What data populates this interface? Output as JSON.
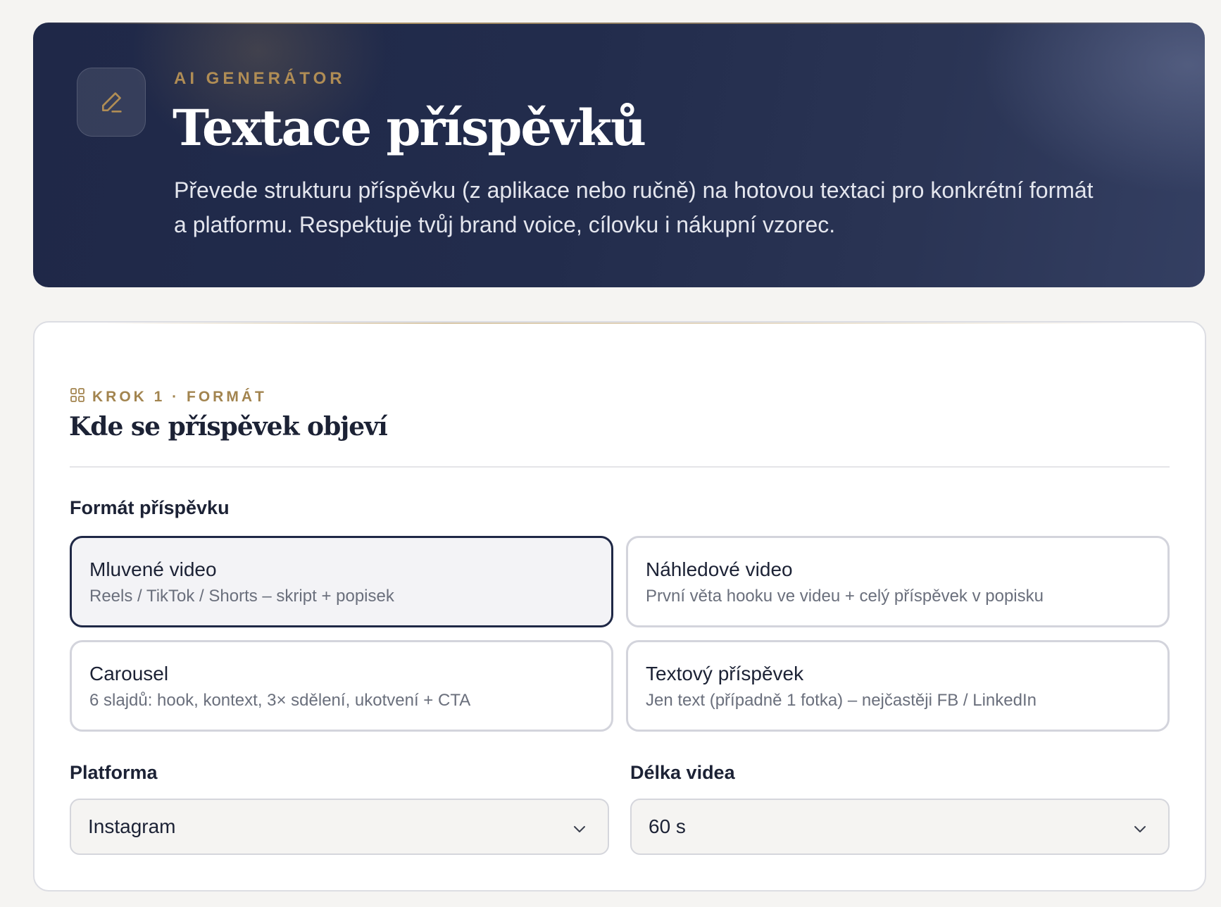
{
  "hero": {
    "icon": "pencil-icon",
    "eyebrow": "AI GENERÁTOR",
    "title": "Textace příspěvků",
    "description": "Převede strukturu příspěvku (z aplikace nebo ručně) na hotovou textaci pro konkrétní formát a platformu. Respektuje tvůj brand voice, cílovku i nákupní vzorec."
  },
  "step": {
    "icon": "grid-icon",
    "label": "KROK 1 · FORMÁT",
    "title": "Kde se příspěvek objeví"
  },
  "format": {
    "label": "Formát příspěvku",
    "selected": "Mluvené video",
    "options": [
      {
        "title": "Mluvené video",
        "subtitle": "Reels / TikTok / Shorts – skript + popisek"
      },
      {
        "title": "Náhledové video",
        "subtitle": "První věta hooku ve videu + celý příspěvek v popisku"
      },
      {
        "title": "Carousel",
        "subtitle": "6 slajdů: hook, kontext, 3× sdělení, ukotvení + CTA"
      },
      {
        "title": "Textový příspěvek",
        "subtitle": "Jen text (případně 1 fotka) – nejčastěji FB / LinkedIn"
      }
    ]
  },
  "platform": {
    "label": "Platforma",
    "value": "Instagram",
    "icon": "chevron-down-icon"
  },
  "video_length": {
    "label": "Délka videa",
    "value": "60 s",
    "icon": "chevron-down-icon"
  },
  "colors": {
    "hero_bg": "#222c4c",
    "accent_gold": "#b08d55",
    "selected_border": "#1f2846",
    "page_bg": "#f5f4f2"
  }
}
